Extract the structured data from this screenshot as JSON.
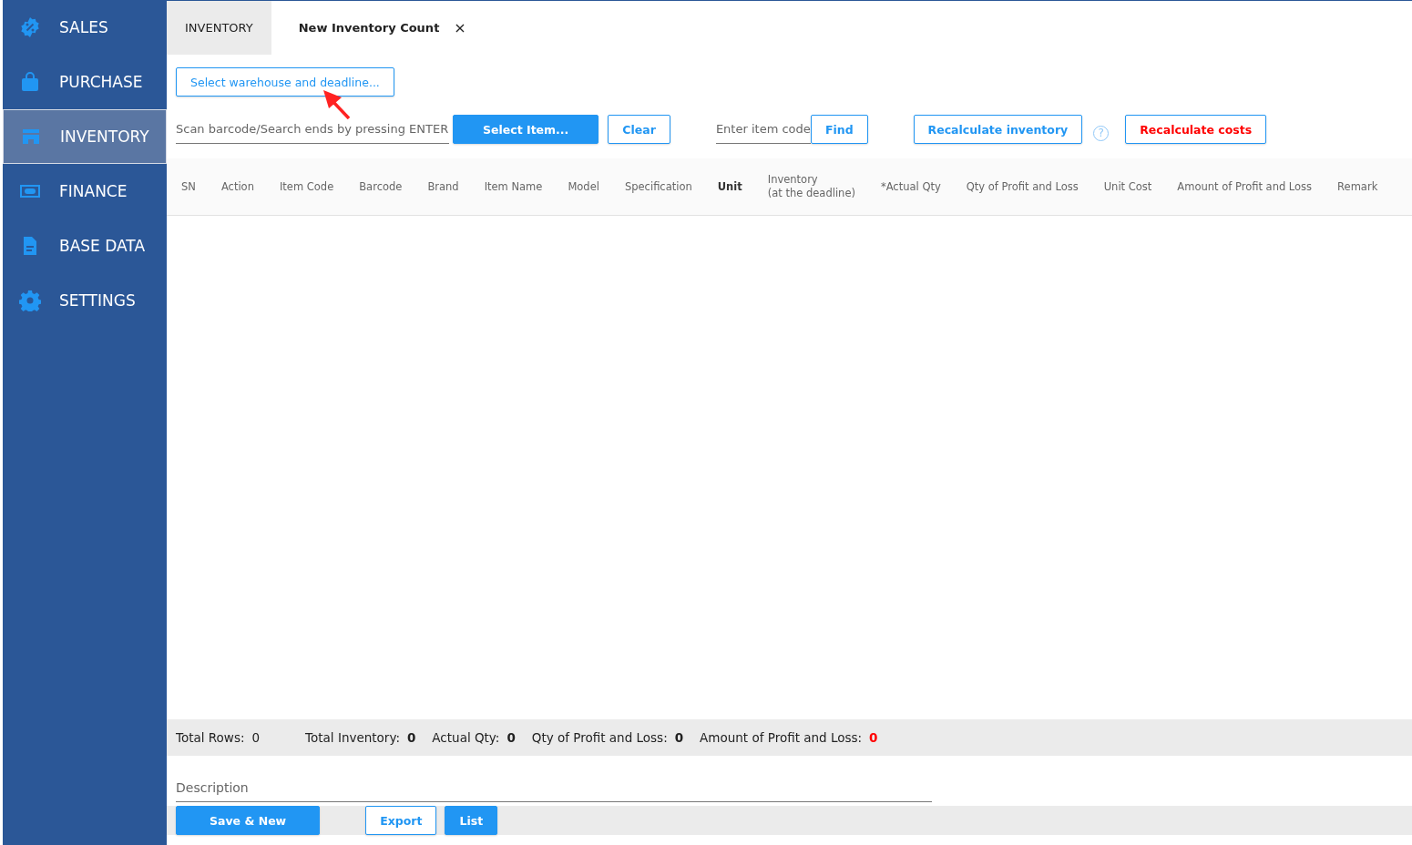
{
  "sidebar": {
    "items": [
      {
        "label": "SALES",
        "selected": false
      },
      {
        "label": "PURCHASE",
        "selected": false
      },
      {
        "label": "INVENTORY",
        "selected": true
      },
      {
        "label": "FINANCE",
        "selected": false
      },
      {
        "label": "BASE DATA",
        "selected": false
      },
      {
        "label": "SETTINGS",
        "selected": false
      }
    ]
  },
  "tabs": [
    {
      "label": "INVENTORY",
      "selected": false,
      "closable": false
    },
    {
      "label": "New Inventory Count",
      "selected": true,
      "closable": true,
      "close": "×"
    }
  ],
  "warehouse_button": "Select warehouse and deadline...",
  "toolbar": [
    {
      "kind": "field",
      "placeholder": "Scan barcode/Search ends by pressing ENTER"
    },
    {
      "kind": "primary",
      "label": "Select Item..."
    },
    {
      "kind": "outline",
      "label": "Clear"
    },
    {
      "kind": "field",
      "placeholder": "Enter item code"
    },
    {
      "kind": "outline",
      "label": "Find"
    },
    {
      "kind": "outline",
      "label": "Recalculate inventory"
    },
    {
      "kind": "help",
      "label": "?"
    },
    {
      "kind": "danger",
      "label": "Recalculate costs"
    }
  ],
  "table": {
    "columns": [
      {
        "label": "SN",
        "emphasized": false
      },
      {
        "label": "Action",
        "emphasized": false
      },
      {
        "label": "Item Code",
        "emphasized": false
      },
      {
        "label": "Barcode",
        "emphasized": false
      },
      {
        "label": "Brand",
        "emphasized": false
      },
      {
        "label": "Item Name",
        "emphasized": false
      },
      {
        "label": "Model",
        "emphasized": false
      },
      {
        "label": "Specification",
        "emphasized": false
      },
      {
        "label": "Unit",
        "emphasized": true
      },
      {
        "label": "Inventory\n(at the deadline)",
        "emphasized": false
      },
      {
        "label": "*Actual Qty",
        "emphasized": false
      },
      {
        "label": "Qty of Profit and Loss",
        "emphasized": false
      },
      {
        "label": "Unit Cost",
        "emphasized": false
      },
      {
        "label": "Amount of Profit and Loss",
        "emphasized": false
      },
      {
        "label": "Remark",
        "emphasized": false
      }
    ]
  },
  "totals": [
    {
      "label": "Total Rows:",
      "value": "0",
      "kind": "plain"
    },
    {
      "label": "Total Inventory:",
      "value": "0",
      "kind": "bold"
    },
    {
      "label": "Actual Qty:",
      "value": "0",
      "kind": "bold"
    },
    {
      "label": "Qty of Profit and Loss:",
      "value": "0",
      "kind": "bold"
    },
    {
      "label": "Amount of Profit and Loss:",
      "value": "0",
      "kind": "alert"
    }
  ],
  "description": {
    "placeholder": "Description"
  },
  "actions": [
    {
      "kind": "primary",
      "label": "Save & New"
    },
    {
      "kind": "outline",
      "label": "Export"
    },
    {
      "kind": "primary",
      "label": "List"
    }
  ]
}
